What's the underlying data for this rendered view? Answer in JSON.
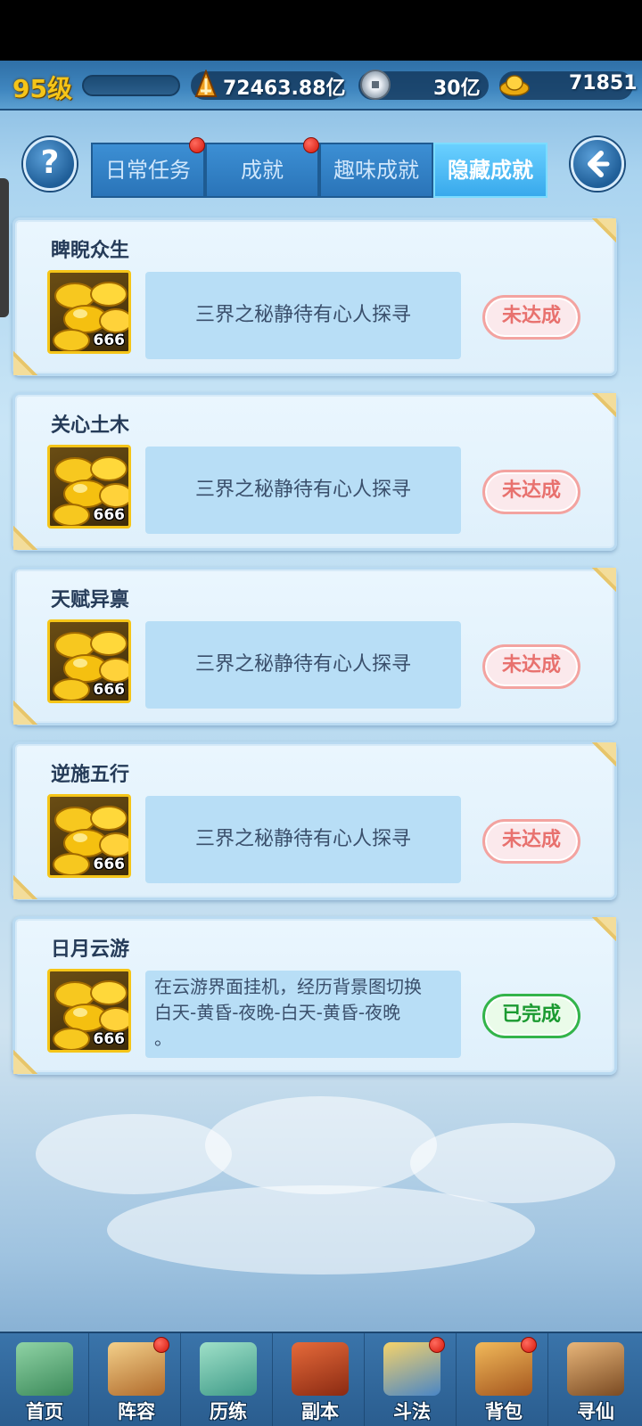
{
  "header": {
    "level": "95级",
    "combat_power": "72463.88亿",
    "silver": "30亿",
    "gold": "71851"
  },
  "tabs": [
    {
      "label": "日常任务",
      "active": false,
      "badge": true
    },
    {
      "label": "成就",
      "active": false,
      "badge": true
    },
    {
      "label": "趣味成就",
      "active": false,
      "badge": false
    },
    {
      "label": "隐藏成就",
      "active": true,
      "badge": false
    }
  ],
  "buttons": {
    "help": "?",
    "back_icon": "back-arrow-icon"
  },
  "achievements": [
    {
      "title": "睥睨众生",
      "reward_count": "666",
      "description": "三界之秘静待有心人探寻",
      "status": "未达成"
    },
    {
      "title": "关心土木",
      "reward_count": "666",
      "description": "三界之秘静待有心人探寻",
      "status": "未达成"
    },
    {
      "title": "天赋异禀",
      "reward_count": "666",
      "description": "三界之秘静待有心人探寻",
      "status": "未达成"
    },
    {
      "title": "逆施五行",
      "reward_count": "666",
      "description": "三界之秘静待有心人探寻",
      "status": "未达成"
    },
    {
      "title": "日月云游",
      "reward_count": "666",
      "description_lines": [
        "在云游界面挂机，经历背景图切换",
        "白天-黄昏-夜晚-白天-黄昏-夜晚",
        "。"
      ],
      "status": "已完成"
    }
  ],
  "nav": [
    {
      "label": "首页",
      "badge": false,
      "icon": "home-icon"
    },
    {
      "label": "阵容",
      "badge": true,
      "icon": "lineup-icon"
    },
    {
      "label": "历练",
      "badge": false,
      "icon": "training-icon"
    },
    {
      "label": "副本",
      "badge": false,
      "icon": "dungeon-icon"
    },
    {
      "label": "斗法",
      "badge": true,
      "icon": "battle-icon"
    },
    {
      "label": "背包",
      "badge": true,
      "icon": "bag-icon"
    },
    {
      "label": "寻仙",
      "badge": false,
      "icon": "seek-immortal-icon"
    }
  ],
  "colors": {
    "accent": "#38a9ec",
    "pending": "#e8716e",
    "done": "#1b9a31",
    "gold": "#f5c518"
  }
}
